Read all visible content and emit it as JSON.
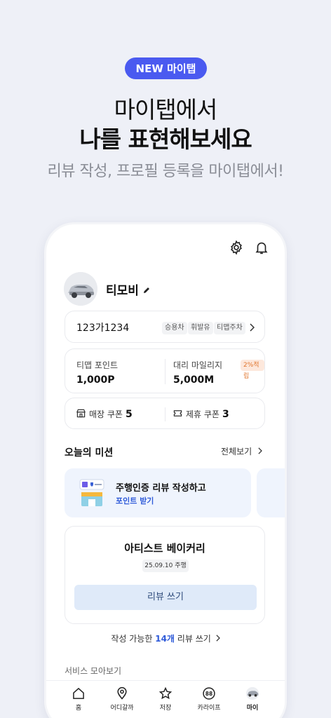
{
  "promo": {
    "badge": "NEW 마이탭",
    "title_line1": "마이탭에서",
    "title_line2": "나를 표현해보세요",
    "subtitle": "리뷰 작성, 프로필 등록을 마이탭에서!"
  },
  "profile": {
    "name": "티모비"
  },
  "vehicle": {
    "plate": "123가1234",
    "tags": [
      "승용차",
      "휘발유",
      "티맵주차"
    ]
  },
  "points": {
    "tmap_label": "티맵 포인트",
    "tmap_value": "1,000P",
    "mileage_label": "대리 마일리지",
    "mileage_value": "5,000M",
    "rate_badge": "2%적립"
  },
  "coupons": {
    "store_label": "매장 쿠폰",
    "store_count": "5",
    "partner_label": "제휴 쿠폰",
    "partner_count": "3"
  },
  "missions": {
    "section_title": "오늘의 미션",
    "view_all": "전체보기",
    "card_title": "주행인증 리뷰 작성하고",
    "card_link": "포인트 받기"
  },
  "review": {
    "store_name": "아티스트 베이커리",
    "visit_badge": "25.09.10 주행",
    "button": "리뷰 쓰기",
    "available_prefix": "작성 가능한",
    "available_count": "14개",
    "available_suffix": "리뷰 쓰기"
  },
  "services": {
    "section_title": "서비스 모아보기"
  },
  "tabbar": {
    "items": [
      "홈",
      "어디갈까",
      "저장",
      "카라이프",
      "마이"
    ],
    "active": "마이"
  },
  "colors": {
    "accent": "#4a5af0",
    "link": "#2f5bd9",
    "rate": "#e0762f"
  }
}
